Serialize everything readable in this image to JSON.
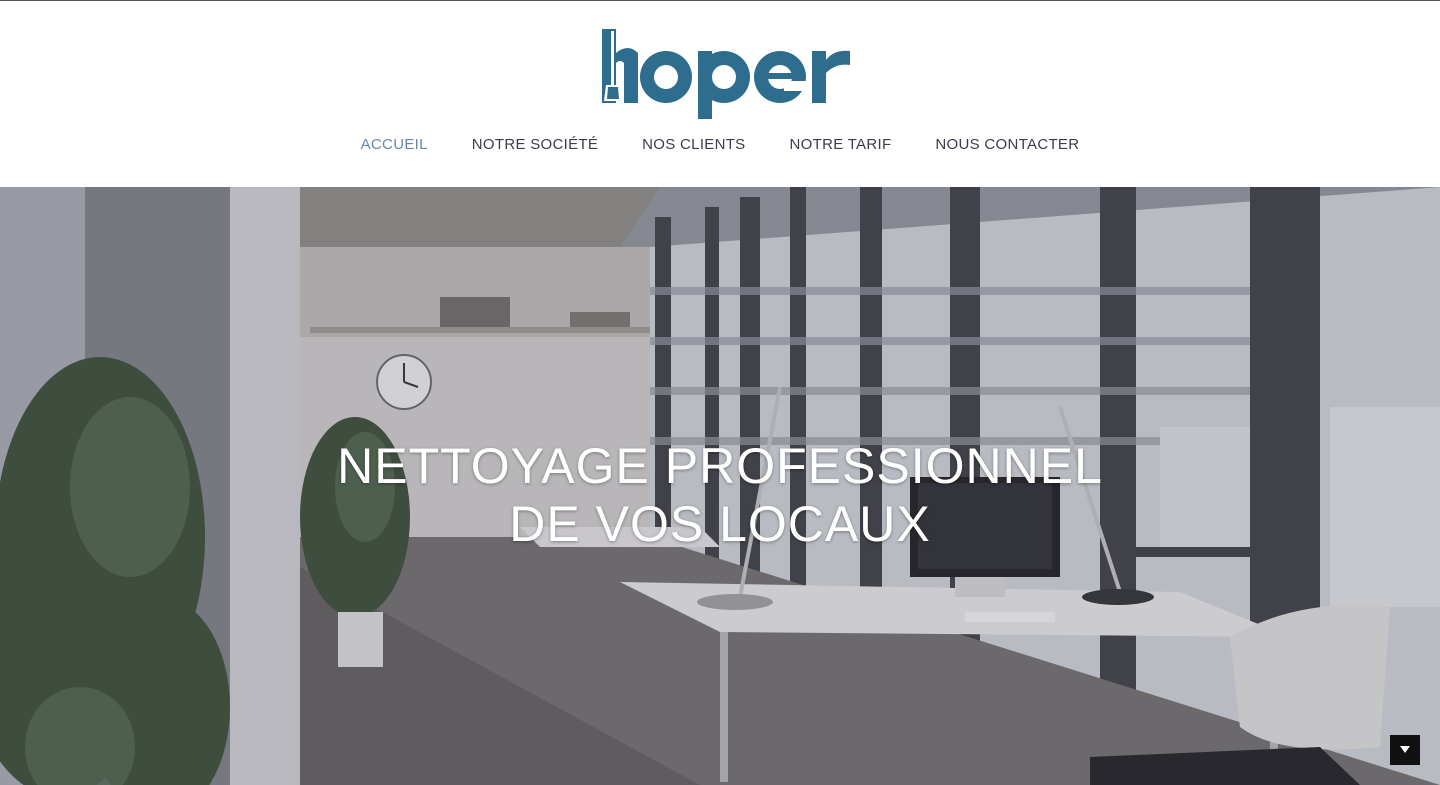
{
  "brand": {
    "logo_text": "hoper",
    "logo_color": "#2e6d8e"
  },
  "nav": {
    "items": [
      {
        "label": "ACCUEIL",
        "active": true
      },
      {
        "label": "NOTRE SOCIÉTÉ",
        "active": false
      },
      {
        "label": "NOS CLIENTS",
        "active": false
      },
      {
        "label": "NOTRE TARIF",
        "active": false
      },
      {
        "label": "NOUS CONTACTER",
        "active": false
      }
    ],
    "active_color": "#6b86a6",
    "text_color": "#3c3c4a"
  },
  "hero": {
    "title_line1": "NETTOYAGE PROFESSIONNEL",
    "title_line2": "DE VOS LOCAUX",
    "image_subject": "office-interior-photo",
    "scroll_button_icon": "triangle-down-icon"
  }
}
